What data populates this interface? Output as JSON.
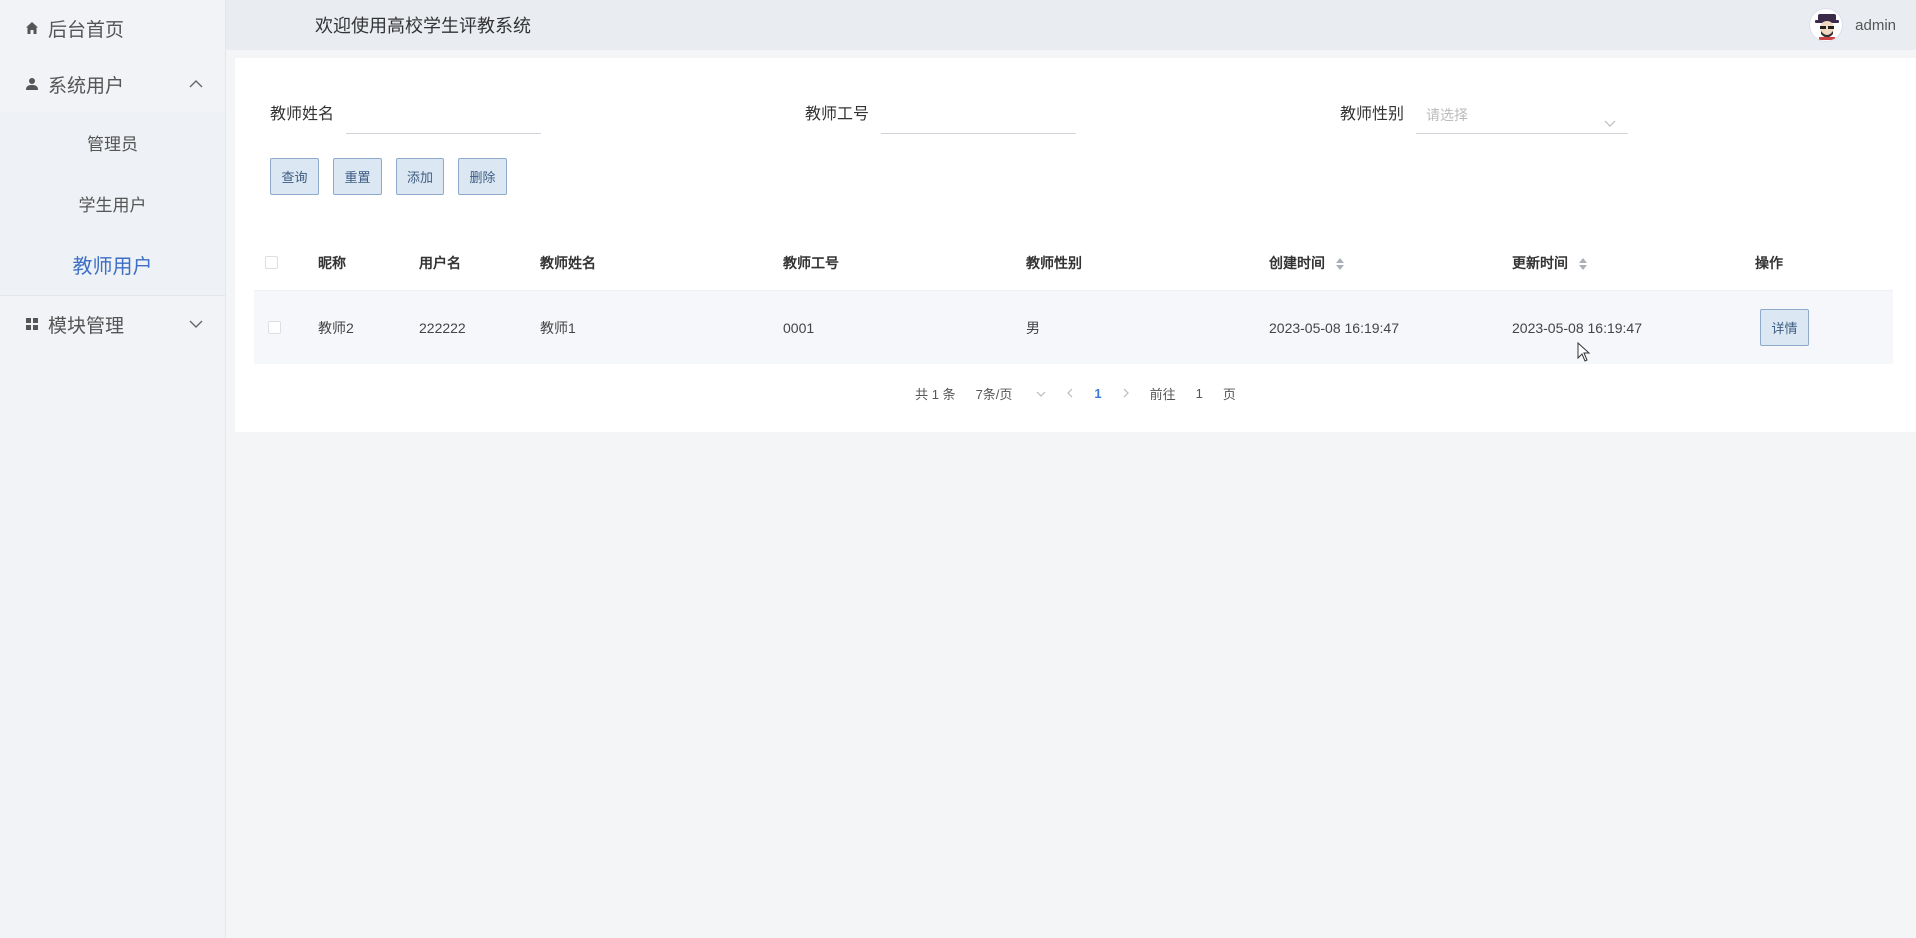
{
  "sidebar": {
    "home": {
      "label": "后台首页",
      "icon": "home-icon"
    },
    "groups": [
      {
        "label": "系统用户",
        "icon": "user-icon",
        "expanded": true,
        "items": [
          "管理员",
          "学生用户",
          "教师用户"
        ],
        "active_index": 2
      },
      {
        "label": "模块管理",
        "icon": "grid-icon",
        "expanded": false
      }
    ]
  },
  "header": {
    "welcome": "欢迎使用高校学生评教系统",
    "username": "admin"
  },
  "filters": {
    "name_label": "教师姓名",
    "id_label": "教师工号",
    "gender_label": "教师性别",
    "gender_placeholder": "请选择"
  },
  "buttons": {
    "query": "查询",
    "reset": "重置",
    "add": "添加",
    "delete": "删除"
  },
  "table": {
    "headers": [
      "昵称",
      "用户名",
      "教师姓名",
      "教师工号",
      "教师性别",
      "创建时间",
      "更新时间",
      "操作"
    ],
    "rows": [
      {
        "nickname": "教师2",
        "username": "222222",
        "teacher_name": "教师1",
        "teacher_id": "0001",
        "gender": "男",
        "created": "2023-05-08 16:19:47",
        "updated": "2023-05-08 16:19:47",
        "action": "详情"
      }
    ]
  },
  "pagination": {
    "total": "共 1 条",
    "page_size": "7条/页",
    "current": "1",
    "goto_prefix": "前往",
    "goto_value": "1",
    "goto_suffix": "页"
  },
  "colors": {
    "accent": "#3d6fc4",
    "button_bg": "#dbe7f3",
    "button_border": "#8eaacb"
  }
}
